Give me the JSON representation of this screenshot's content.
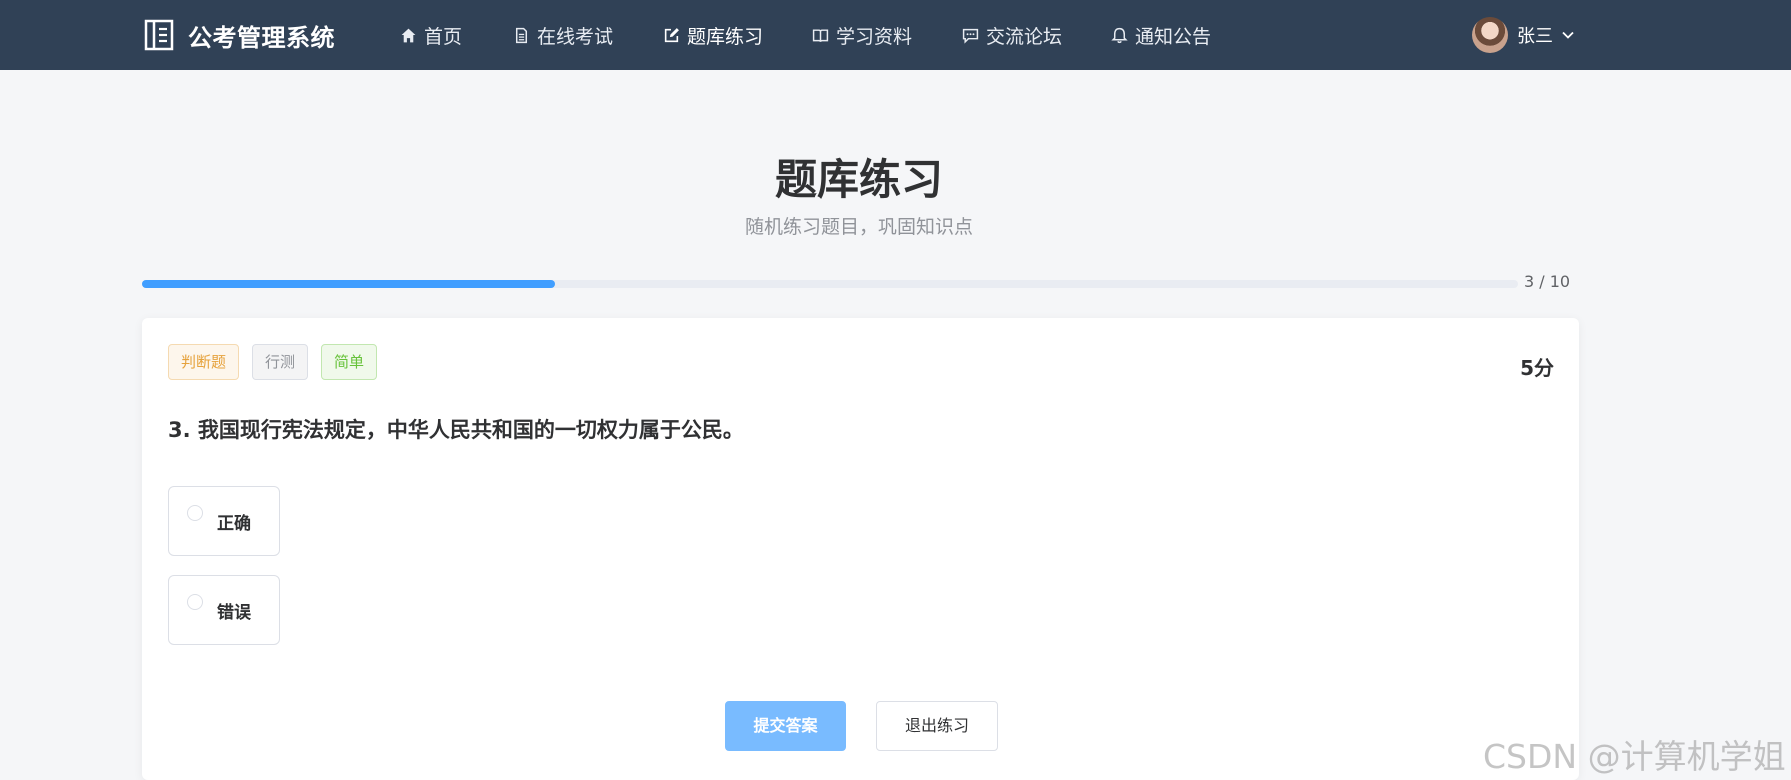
{
  "app": {
    "title": "公考管理系统",
    "nav": [
      {
        "label": "首页",
        "icon": "home-icon"
      },
      {
        "label": "在线考试",
        "icon": "document-icon"
      },
      {
        "label": "题库练习",
        "icon": "edit-icon"
      },
      {
        "label": "学习资料",
        "icon": "book-icon"
      },
      {
        "label": "交流论坛",
        "icon": "chat-icon"
      },
      {
        "label": "通知公告",
        "icon": "bell-icon"
      }
    ],
    "user": {
      "name": "张三",
      "menu_icon": "chevron-down-icon"
    }
  },
  "header": {
    "title": "题库练习",
    "subtitle": "随机练习题目，巩固知识点"
  },
  "progress": {
    "current": 3,
    "total": 10,
    "text": "3 / 10",
    "fraction": 0.3
  },
  "question": {
    "tags": {
      "type": "判断题",
      "subject": "行测",
      "difficulty": "简单"
    },
    "score": "5分",
    "text": "3. 我国现行宪法规定，中华人民共和国的一切权力属于公民。",
    "options": [
      {
        "label": "正确"
      },
      {
        "label": "错误"
      }
    ]
  },
  "actions": {
    "submit": "提交答案",
    "exit": "退出练习"
  },
  "watermark": "CSDN @计算机学姐",
  "colors": {
    "nav_bg": "#304156",
    "accent": "#409eff",
    "submit_bg": "#79bbff"
  }
}
